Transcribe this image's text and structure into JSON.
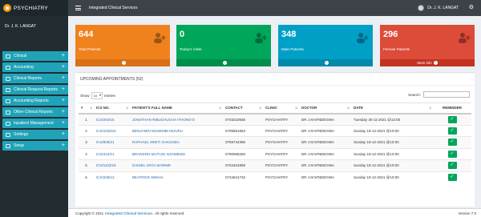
{
  "brand": {
    "name": "PSYCHIATRY"
  },
  "user": {
    "name": "Dr. J. K. LANGAT"
  },
  "header": {
    "title": "Integrated Clinical Services",
    "user_name": "Dr. J. K. LANGAT"
  },
  "sidebar": {
    "items": [
      {
        "label": "Clinical"
      },
      {
        "label": "Accounting"
      },
      {
        "label": "Clinical Reports"
      },
      {
        "label": "Clinical Request Reports"
      },
      {
        "label": "Accounting Reports"
      },
      {
        "label": "Other Clinical Reports"
      },
      {
        "label": "Inpatient Management"
      },
      {
        "label": "Settings"
      },
      {
        "label": "Setup"
      }
    ]
  },
  "stats": [
    {
      "value": "644",
      "label": "Total Patients",
      "color": "#f0821e",
      "foot_color": "#d87017",
      "foot_text": ""
    },
    {
      "value": "0",
      "label": "Today's Visits",
      "color": "#00a65a",
      "foot_color": "#008d4c",
      "foot_text": ""
    },
    {
      "value": "348",
      "label": "Male Patients",
      "color": "#00a0c6",
      "foot_color": "#0089aa",
      "foot_text": ""
    },
    {
      "value": "296",
      "label": "Female Patients",
      "color": "#dd4b39",
      "foot_color": "#c23321",
      "foot_text": "More info"
    }
  ],
  "appointments": {
    "title": "UPCOMING APPOINTMENTS (52)",
    "show_label": "Show",
    "show_value": "10",
    "entries_label": "entries",
    "search_label": "Search:",
    "columns": [
      "#",
      "ICS NO.",
      "PATIENT'S FULL NAME",
      "CONTACT",
      "CLINIC",
      "DOCTOR",
      "DATE",
      "REMINDER"
    ],
    "rows": [
      {
        "num": "1",
        "ics": "ICS/204/15",
        "name": "JONATHAN RIBUCHUCHA ITHONG'O",
        "contact": "0703218935",
        "clinic": "PSYCHIATRY",
        "doctor": "DR J M M'NDEGWA",
        "date": "Tuesday 30-11-2021 @13:00"
      },
      {
        "num": "2",
        "ics": "ICS/1026/21",
        "name": "BENJAMIN MUSEMBI MUURU",
        "contact": "0705861863",
        "clinic": "PSYCHIATRY",
        "doctor": "DR J M M'NDEGWA",
        "date": "Sunday 19-12-2021 @10:00"
      },
      {
        "num": "3",
        "ics": "ICS/808/21",
        "name": "RAPHAEL MWITI GAKUNDA",
        "contact": "0759744396",
        "clinic": "PSYCHIATRY",
        "doctor": "DR J M M'NDEGWA",
        "date": "Sunday 19-12-2021 @10:00"
      },
      {
        "num": "4",
        "ics": "ICS/414/21",
        "name": "BRANDON MUTUGI NJOMBIGE",
        "contact": "0790595260",
        "clinic": "PSYCHIATRY",
        "doctor": "DR J M M'NDEGWA",
        "date": "Sunday 19-12-2021 @10:00"
      },
      {
        "num": "5",
        "ics": "ICS/1103/18",
        "name": "DANIEL ARGA BARIME",
        "contact": "0704404859",
        "clinic": "PSYCHIATRY",
        "doctor": "DR J M M'NDEGWA",
        "date": "Sunday 19-12-2021 @10:00"
      },
      {
        "num": "6",
        "ics": "ICS/208/12",
        "name": "BEATRICE MWIHA",
        "contact": "0734641732",
        "clinic": "PSYCHIATRY",
        "doctor": "DR J M M'NDEGWA",
        "date": "Sunday 19-12-2021 @10:00"
      }
    ]
  },
  "footer": {
    "copyright": "Copyright © 2021",
    "brand_link": "Integrated Clinical Services.",
    "rights": "All rights reserved.",
    "version": "Version 7.0"
  }
}
